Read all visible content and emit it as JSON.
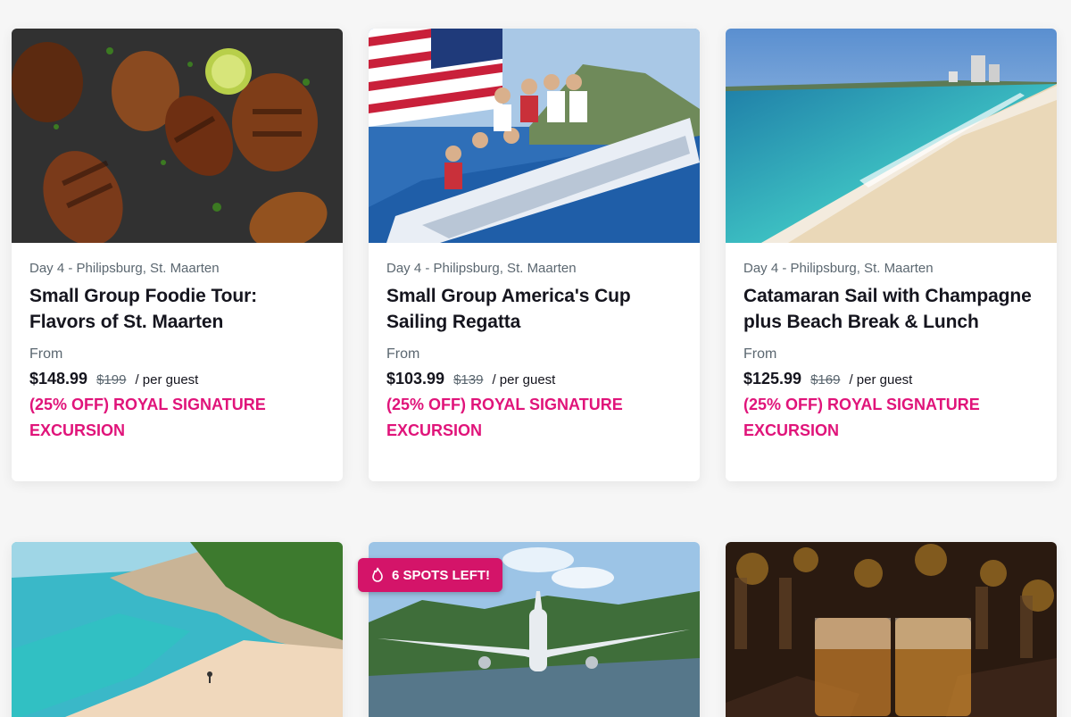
{
  "cards": [
    {
      "image": "grilled-chicken-photo",
      "location": "Day 4 - Philipsburg, St. Maarten",
      "title": "Small Group Foodie Tour: Flavors of St. Maarten",
      "from_label": "From",
      "price": "$148.99",
      "original_price": "$199",
      "per_guest": "/ per guest",
      "promo": "(25% OFF) ROYAL SIGNATURE EXCURSION"
    },
    {
      "image": "sailing-regatta-photo",
      "location": "Day 4 - Philipsburg, St. Maarten",
      "title": "Small Group America's Cup Sailing Regatta",
      "from_label": "From",
      "price": "$103.99",
      "original_price": "$139",
      "per_guest": "/ per guest",
      "promo": "(25% OFF) ROYAL SIGNATURE EXCURSION"
    },
    {
      "image": "beach-photo",
      "location": "Day 4 - Philipsburg, St. Maarten",
      "title": "Catamaran Sail with Champagne plus Beach Break & Lunch",
      "from_label": "From",
      "price": "$125.99",
      "original_price": "$169",
      "per_guest": "/ per guest",
      "promo": "(25% OFF) ROYAL SIGNATURE EXCURSION"
    },
    {
      "image": "cove-beach-photo"
    },
    {
      "image": "airplane-landing-photo"
    },
    {
      "image": "whiskey-glasses-photo"
    }
  ],
  "badge": {
    "icon": "flame-icon",
    "text": "6 SPOTS LEFT!"
  },
  "colors": {
    "promo": "#e0147a",
    "badge": "#d41469",
    "text": "#15151e",
    "muted": "#5b6770"
  }
}
